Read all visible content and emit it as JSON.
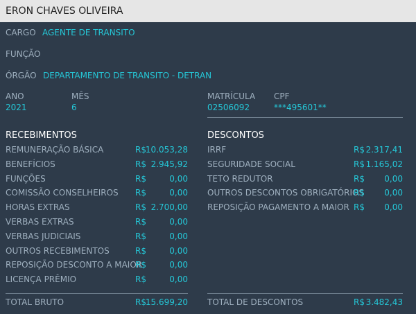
{
  "employee": {
    "name": "ERON CHAVES OLIVEIRA",
    "cargo_label": "CARGO",
    "cargo": "AGENTE DE TRANSITO",
    "funcao_label": "FUNÇÃO",
    "orgao_label": "ÓRGÃO",
    "orgao": "DEPARTAMENTO DE TRANSITO - DETRAN",
    "ano_label": "ANO",
    "ano": "2021",
    "mes_label": "MÊS",
    "mes": "6",
    "matricula_label": "MATRÍCULA",
    "matricula": "02506092",
    "cpf_label": "CPF",
    "cpf": "***495601**"
  },
  "currency": "R$",
  "recebimentos": {
    "title": "RECEBIMENTOS",
    "items": [
      {
        "label": "REMUNERAÇÃO BÁSICA",
        "value": "10.053,28"
      },
      {
        "label": "BENEFÍCIOS",
        "value": "2.945,92"
      },
      {
        "label": "FUNÇÕES",
        "value": "0,00"
      },
      {
        "label": "COMISSÃO CONSELHEIROS",
        "value": "0,00"
      },
      {
        "label": "HORAS EXTRAS",
        "value": "2.700,00"
      },
      {
        "label": "VERBAS EXTRAS",
        "value": "0,00"
      },
      {
        "label": "VERBAS JUDICIAIS",
        "value": "0,00"
      },
      {
        "label": "OUTROS RECEBIMENTOS",
        "value": "0,00"
      },
      {
        "label": "REPOSIÇÃO DESCONTO A MAIOR",
        "value": "0,00"
      },
      {
        "label": "LICENÇA PRÊMIO",
        "value": "0,00"
      }
    ],
    "total_label": "TOTAL BRUTO",
    "total_value": "15.699,20"
  },
  "descontos": {
    "title": "DESCONTOS",
    "items": [
      {
        "label": "IRRF",
        "value": "2.317,41"
      },
      {
        "label": "SEGURIDADE SOCIAL",
        "value": "1.165,02"
      },
      {
        "label": "TETO REDUTOR",
        "value": "0,00"
      },
      {
        "label": "OUTROS DESCONTOS OBRIGATÓRIOS",
        "value": "0,00"
      },
      {
        "label": "REPOSIÇÃO PAGAMENTO A MAIOR",
        "value": "0,00"
      }
    ],
    "total_label": "TOTAL DE DESCONTOS",
    "total_value": "3.482,43"
  }
}
